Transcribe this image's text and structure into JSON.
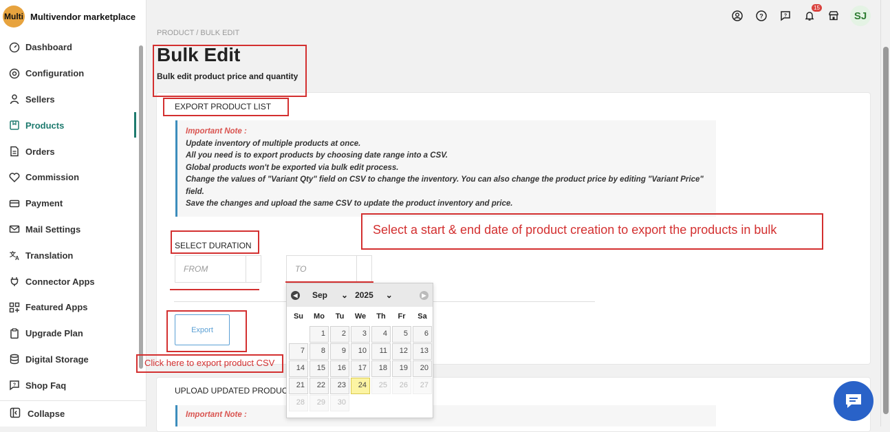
{
  "brand": {
    "logo_text": "Multi",
    "name": "Multivendor marketplace"
  },
  "nav": [
    {
      "label": "Dashboard",
      "icon": "dashboard-icon"
    },
    {
      "label": "Configuration",
      "icon": "gear-icon"
    },
    {
      "label": "Sellers",
      "icon": "user-icon"
    },
    {
      "label": "Products",
      "icon": "product-icon",
      "active": true
    },
    {
      "label": "Orders",
      "icon": "orders-icon"
    },
    {
      "label": "Commission",
      "icon": "commission-icon"
    },
    {
      "label": "Payment",
      "icon": "payment-icon"
    },
    {
      "label": "Mail Settings",
      "icon": "mail-icon"
    },
    {
      "label": "Translation",
      "icon": "translation-icon"
    },
    {
      "label": "Connector Apps",
      "icon": "plug-icon"
    },
    {
      "label": "Featured Apps",
      "icon": "apps-icon"
    },
    {
      "label": "Upgrade Plan",
      "icon": "clipboard-icon"
    },
    {
      "label": "Digital Storage",
      "icon": "database-icon"
    },
    {
      "label": "Shop Faq",
      "icon": "faq-icon"
    }
  ],
  "collapse_label": "Collapse",
  "topbar": {
    "notification_count": "15",
    "avatar": "SJ"
  },
  "breadcrumb": "PRODUCT / BULK EDIT",
  "page": {
    "title": "Bulk Edit",
    "subtitle": "Bulk edit product price and quantity"
  },
  "export_section": {
    "heading": "EXPORT PRODUCT LIST",
    "note_title": "Important Note :",
    "note_lines": [
      "Update inventory of multiple products at once.",
      "All you need is to export products by choosing date range into a CSV.",
      "Global products won't be exported via bulk edit process.",
      "Change the values of \"Variant Qty\" field on CSV to change the inventory. You can also change the product price by editing \"Variant Price\" field.",
      "Save the changes and upload the same CSV to update the product inventory and price."
    ],
    "duration_label": "SELECT DURATION",
    "from_placeholder": "FROM",
    "to_placeholder": "TO",
    "export_button": "Export"
  },
  "upload_section": {
    "heading": "UPLOAD UPDATED PRODUCT LIST",
    "note_title": "Important Note :"
  },
  "calendar": {
    "month": "Sep",
    "year": "2025",
    "weekdays": [
      "Su",
      "Mo",
      "Tu",
      "We",
      "Th",
      "Fr",
      "Sa"
    ],
    "first_weekday": 1,
    "days_in_month": 30,
    "today": 24
  },
  "annotations": {
    "date_hint": "Select a start & end date of product creation to export the products in bulk",
    "export_hint": "Click here to export product CSV"
  },
  "colors": {
    "accent": "#1d7a6e",
    "annotation": "#d32f2f",
    "chat": "#2962c8"
  }
}
